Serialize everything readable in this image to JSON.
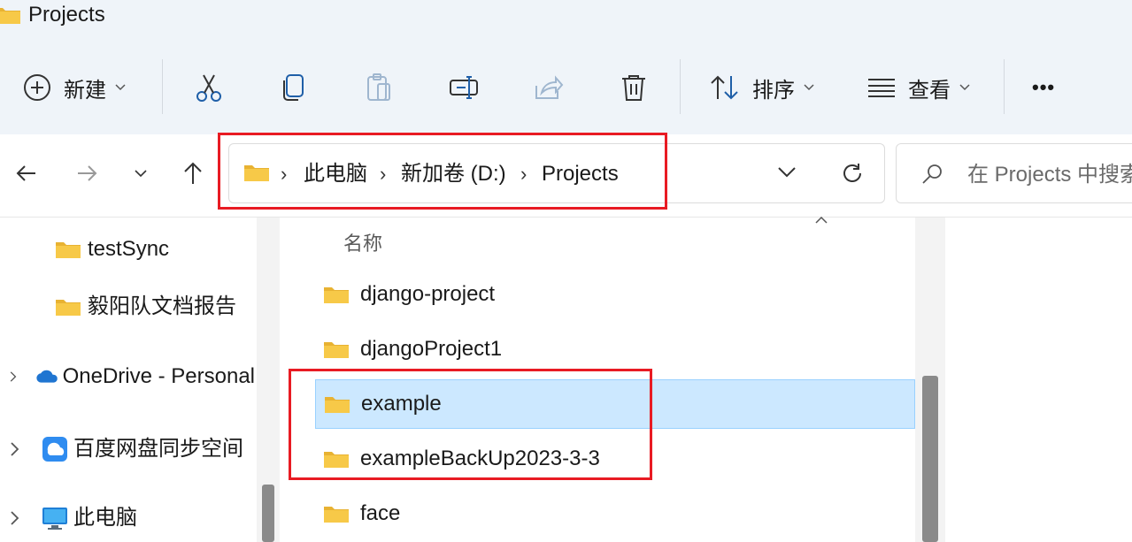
{
  "window": {
    "title": "Projects"
  },
  "toolbar": {
    "new_label": "新建",
    "sort_label": "排序",
    "view_label": "查看",
    "more_label": "•••"
  },
  "address": {
    "crumbs": [
      "此电脑",
      "新加卷 (D:)",
      "Projects"
    ]
  },
  "search": {
    "placeholder": "在 Projects 中搜索"
  },
  "nav": {
    "items": [
      {
        "label": "testSync",
        "icon": "folder-icon"
      },
      {
        "label": "毅阳队文档报告",
        "icon": "folder-icon"
      },
      {
        "label": "OneDrive - Personal",
        "icon": "onedrive-icon"
      },
      {
        "label": "百度网盘同步空间",
        "icon": "baidu-netdisk-icon"
      },
      {
        "label": "此电脑",
        "icon": "computer-icon"
      }
    ]
  },
  "list": {
    "column_name": "名称",
    "files": [
      {
        "name": "django-project",
        "selected": false
      },
      {
        "name": "djangoProject1",
        "selected": false
      },
      {
        "name": "example",
        "selected": true
      },
      {
        "name": "exampleBackUp2023-3-3",
        "selected": false
      },
      {
        "name": "face",
        "selected": false
      }
    ]
  },
  "colors": {
    "chrome": "#eff4f9",
    "selection": "#cce8ff",
    "highlight_box": "#e81b23",
    "folder": "#f7c948"
  }
}
